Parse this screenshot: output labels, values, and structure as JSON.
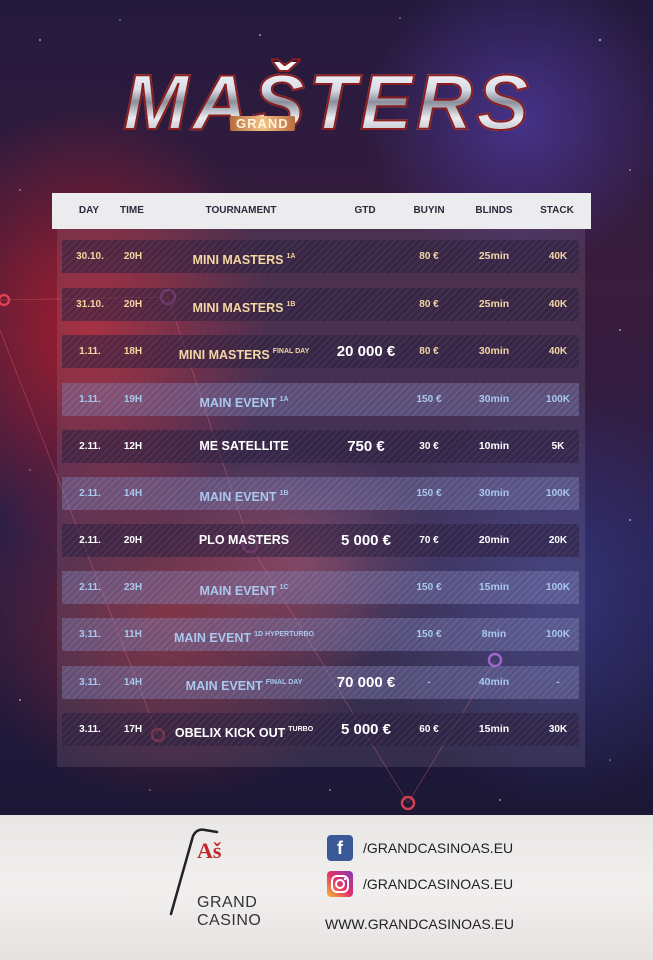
{
  "title": {
    "main": "MAŠTERS",
    "sub": "GRAND"
  },
  "header": {
    "day": "DAY",
    "time": "TIME",
    "tournament": "TOURNAMENT",
    "gtd": "GTD",
    "buyin": "BUYIN",
    "blinds": "BLINDS",
    "stack": "STACK"
  },
  "rows": [
    {
      "day": "30.10.",
      "time": "20H",
      "name": "MINI MASTERS",
      "sup": "1A",
      "gtd": "",
      "buyin": "80 €",
      "blinds": "25min",
      "stack": "40K",
      "style": "dark",
      "color": "gold"
    },
    {
      "day": "31.10.",
      "time": "20H",
      "name": "MINI MASTERS",
      "sup": "1B",
      "gtd": "",
      "buyin": "80 €",
      "blinds": "25min",
      "stack": "40K",
      "style": "dark",
      "color": "gold"
    },
    {
      "day": "1.11.",
      "time": "18H",
      "name": "MINI MASTERS",
      "sup": "FINAL DAY",
      "gtd": "20 000 €",
      "buyin": "80 €",
      "blinds": "30min",
      "stack": "40K",
      "style": "dark",
      "color": "gold"
    },
    {
      "day": "1.11.",
      "time": "19H",
      "name": "MAIN EVENT",
      "sup": "1A",
      "gtd": "",
      "buyin": "150 €",
      "blinds": "30min",
      "stack": "100K",
      "style": "light",
      "color": "blue"
    },
    {
      "day": "2.11.",
      "time": "12H",
      "name": "ME SATELLITE",
      "sup": "",
      "gtd": "750 €",
      "buyin": "30 €",
      "blinds": "10min",
      "stack": "5K",
      "style": "dark",
      "color": "white"
    },
    {
      "day": "2.11.",
      "time": "14H",
      "name": "MAIN EVENT",
      "sup": "1B",
      "gtd": "",
      "buyin": "150 €",
      "blinds": "30min",
      "stack": "100K",
      "style": "light",
      "color": "blue"
    },
    {
      "day": "2.11.",
      "time": "20H",
      "name": "PLO MASTERS",
      "sup": "",
      "gtd": "5 000 €",
      "buyin": "70 €",
      "blinds": "20min",
      "stack": "20K",
      "style": "dark",
      "color": "white"
    },
    {
      "day": "2.11.",
      "time": "23H",
      "name": "MAIN EVENT",
      "sup": "1C",
      "gtd": "",
      "buyin": "150 €",
      "blinds": "15min",
      "stack": "100K",
      "style": "light",
      "color": "blue"
    },
    {
      "day": "3.11.",
      "time": "11H",
      "name": "MAIN EVENT",
      "sup": "1D HYPERTURBO",
      "gtd": "",
      "buyin": "150 €",
      "blinds": "8min",
      "stack": "100K",
      "style": "light",
      "color": "blue"
    },
    {
      "day": "3.11.",
      "time": "14H",
      "name": "MAIN EVENT",
      "sup": "FINAL DAY",
      "gtd": "70 000 €",
      "buyin": "-",
      "blinds": "40min",
      "stack": "-",
      "style": "light",
      "color": "blue"
    },
    {
      "day": "3.11.",
      "time": "17H",
      "name": "OBELIX KICK OUT",
      "sup": "TURBO",
      "gtd": "5 000 €",
      "buyin": "60 €",
      "blinds": "15min",
      "stack": "30K",
      "style": "dark",
      "color": "white"
    }
  ],
  "footer": {
    "brand_as": "Aš",
    "brand_grand": "GRAND",
    "brand_casino": "CASINO",
    "facebook": "/GRANDCASINOAS.EU",
    "instagram": "/GRANDCASINOAS.EU",
    "website": "WWW.GRANDCASINOAS.EU",
    "facebook_icon": "facebook-icon",
    "instagram_icon": "instagram-icon"
  }
}
